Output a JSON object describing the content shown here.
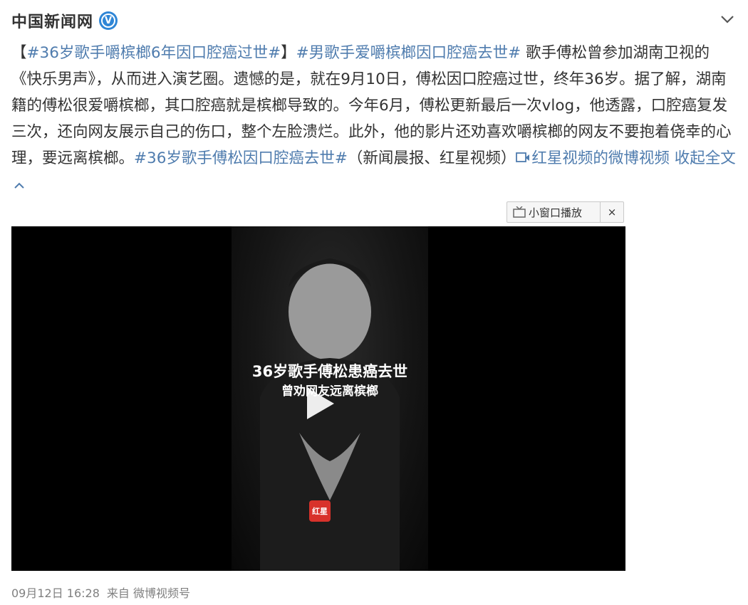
{
  "header": {
    "author": "中国新闻网",
    "verified_icon": "verified-v-icon"
  },
  "post": {
    "tag1": "#36岁歌手嚼槟榔6年因口腔癌过世#",
    "bracket_open": "【",
    "bracket_close": "】",
    "tag2": "#男歌手爱嚼槟榔因口腔癌去世#",
    "body": " 歌手傅松曾参加湖南卫视的《快乐男声》，从而进入演艺圈。遗憾的是，就在9月10日，傅松因口腔癌过世，终年36岁。据了解，湖南籍的傅松很爱嚼槟榔，其口腔癌就是槟榔导致的。今年6月，傅松更新最后一次vlog，他透露，口腔癌复发三次，还向网友展示自己的伤口，整个左脸溃烂。此外，他的影片还劝喜欢嚼槟榔的网友不要抱着侥幸的心理，要远离槟榔。",
    "tag3": "#36岁歌手傅松因口腔癌去世#",
    "source_note": "（新闻晨报、红星视频）",
    "video_link": "红星视频的微博视频",
    "collapse": "收起全文"
  },
  "mini_player": {
    "label": "小窗口播放",
    "close": "×"
  },
  "video": {
    "title": "36岁歌手傅松患癌去世",
    "subtitle": "曾劝网友远离槟榔",
    "watermark": "红星"
  },
  "footer": {
    "time": "09月12日 16:28",
    "source": "来自 微博视频号"
  },
  "colors": {
    "link": "#4f7cae",
    "text": "#333333",
    "meta": "#808080",
    "badge": "#2f86d6"
  }
}
